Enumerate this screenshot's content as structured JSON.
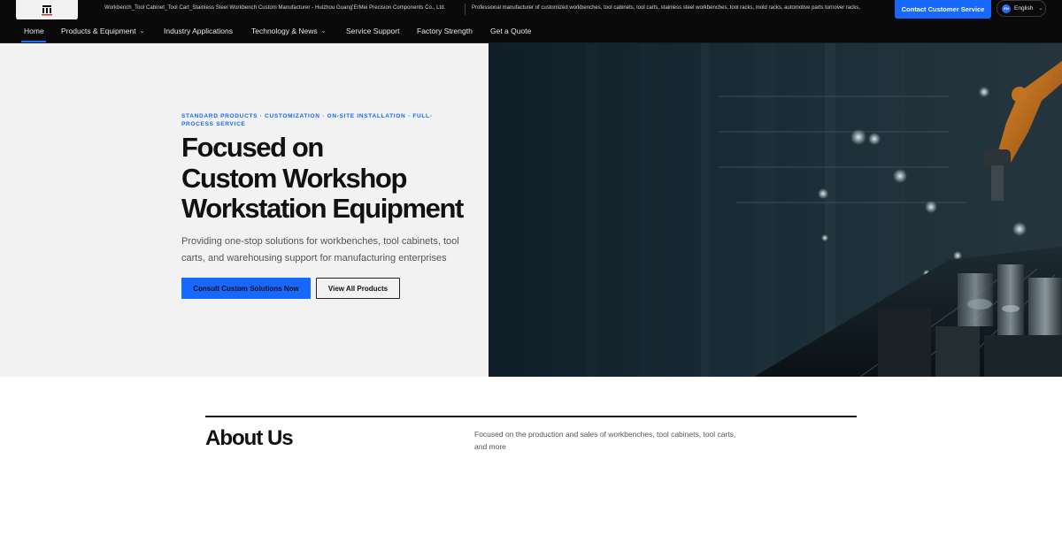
{
  "topbar": {
    "logo_name": "GuangErMei logo",
    "site_title": "Workbench_Tool Cabinet_Tool Cart_Stainless Steel Workbench Custom Manufacturer - Huizhou Guang'ErMei Precision Components Co., Ltd.",
    "tagline": "Professional manufacturer of customized workbenches, tool cabinets, tool carts, stainless steel workbenches, tool racks, mold racks, automotive parts turnover racks,",
    "contact_label": "Contact Customer Service",
    "language": {
      "code": "EN",
      "label": "English",
      "icon": "chevron-down-icon"
    }
  },
  "nav": {
    "items": [
      {
        "label": "Home",
        "active": true,
        "has_dropdown": false
      },
      {
        "label": "Products & Equipment",
        "active": false,
        "has_dropdown": true
      },
      {
        "label": "Industry Applications",
        "active": false,
        "has_dropdown": false
      },
      {
        "label": "Technology & News",
        "active": false,
        "has_dropdown": true
      },
      {
        "label": "Service Support",
        "active": false,
        "has_dropdown": false
      },
      {
        "label": "Factory Strength",
        "active": false,
        "has_dropdown": false
      },
      {
        "label": "Get a Quote",
        "active": false,
        "has_dropdown": false
      }
    ],
    "accent_color": "#1668ff"
  },
  "hero": {
    "eyebrow": "Standard Products · Customization · On-site Installation · Full-Process Service",
    "title_lines": [
      "Focused on",
      "Custom Workshop",
      "Workstation Equipment"
    ],
    "subtitle": "Providing one-stop solutions for workbenches, tool cabinets, tool carts, and warehousing support for manufacturing enterprises",
    "primary_cta": "Consult Custom Solutions Now",
    "secondary_cta": "View All Products",
    "image_description_icon": "factory-robot-image"
  },
  "about": {
    "title": "About Us",
    "description": "Focused on the production and sales of workbenches, tool cabinets, tool carts, and more"
  },
  "colors": {
    "accent": "#1668ff",
    "dark_bg": "#0a0a0a",
    "hero_bg": "#f2f2f2",
    "text_dark": "#111111"
  }
}
